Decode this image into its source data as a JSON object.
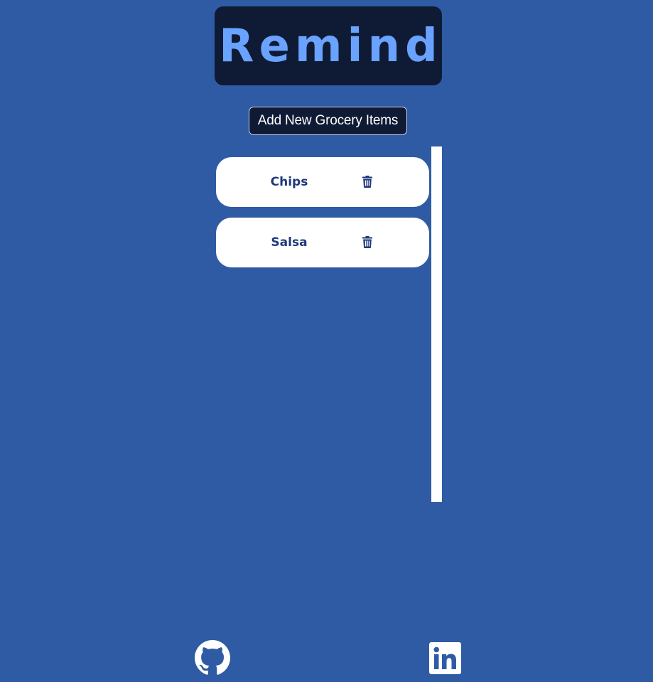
{
  "header": {
    "logo_text": "Remind"
  },
  "toolbar": {
    "add_label": "Add New Grocery Items"
  },
  "grocery_list": {
    "items": [
      {
        "label": "Chips",
        "action_icon": "trash-icon"
      },
      {
        "label": "Salsa",
        "action_icon": "trash-icon"
      }
    ]
  },
  "footer": {
    "links": [
      {
        "icon": "github-icon"
      },
      {
        "icon": "linkedin-icon"
      }
    ]
  },
  "colors": {
    "background": "#2f5ba4",
    "logo_bg": "#0f1b35",
    "logo_text": "#6aa2ff",
    "card_bg": "#ffffff",
    "card_text": "#1e3a78"
  }
}
